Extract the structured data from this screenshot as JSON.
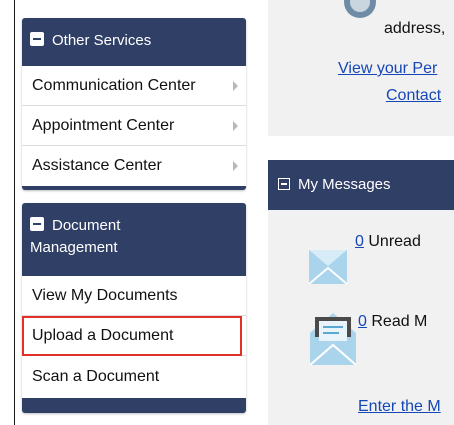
{
  "sidebar": {
    "other_services": {
      "header": "Other Services",
      "items": [
        "Communication Center",
        "Appointment Center",
        "Assistance Center"
      ]
    },
    "document_management": {
      "header_line1": "Document",
      "header_line2": "Management",
      "items": [
        "View My Documents",
        "Upload a Document",
        "Scan a Document"
      ]
    }
  },
  "top_panel": {
    "address_text": "address,",
    "link1": "View your Per",
    "link2": "Contact"
  },
  "messages": {
    "header": "My Messages",
    "unread_count": "0",
    "unread_label": "Unread",
    "read_count": "0",
    "read_label": "Read M",
    "footer_link": "Enter the M"
  }
}
